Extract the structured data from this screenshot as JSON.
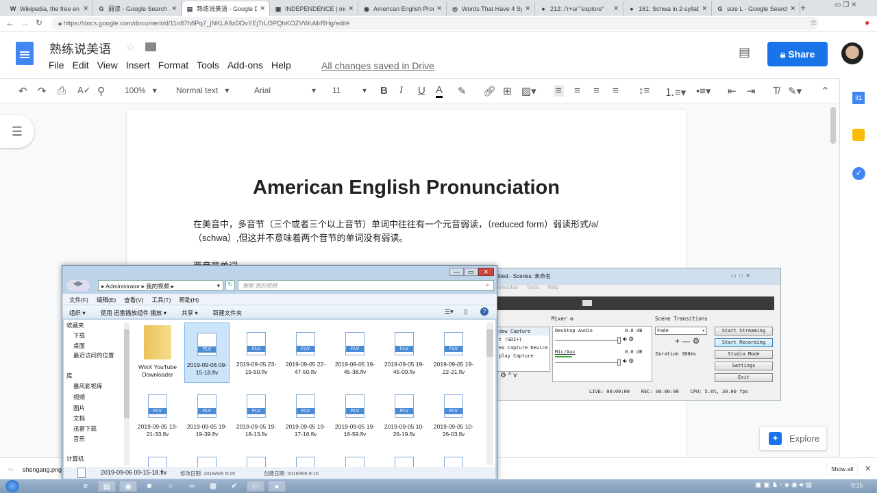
{
  "browser": {
    "tabs": [
      {
        "icon": "W",
        "title": "Wikipedia, the free en"
      },
      {
        "icon": "G",
        "title": "弱读 - Google Search"
      },
      {
        "icon": "▤",
        "title": "熟练说美语 - Google D"
      },
      {
        "icon": "▣",
        "title": "INDEPENDENCE | mea"
      },
      {
        "icon": "◉",
        "title": "American English Pron"
      },
      {
        "icon": "◎",
        "title": "Words That Have 4 Sy"
      },
      {
        "icon": "●",
        "title": "212: /'r+ə/ \"explore\""
      },
      {
        "icon": "●",
        "title": "161: Schwa in 2-syllab"
      },
      {
        "icon": "G",
        "title": "size L - Google Search"
      }
    ],
    "active_tab": 2,
    "url": "https://docs.google.com/document/d/11o87h8Pq7_jNKLA9zDDvYEjTrLOPQhKOZVWuMrRHg/edit#"
  },
  "docs": {
    "title": "熟练说美语",
    "menu": [
      "File",
      "Edit",
      "View",
      "Insert",
      "Format",
      "Tools",
      "Add-ons",
      "Help"
    ],
    "save_status": "All changes saved in Drive",
    "share_label": "Share",
    "toolbar": {
      "zoom": "100%",
      "style": "Normal text",
      "font": "Arial",
      "size": "11"
    },
    "heading": "American English Pronunciation",
    "paragraph1": "在美音中，多音节（三个或者三个以上音节）单词中往往有一个元音弱读，（reduced form）弱读形式/ə/（schwa）,但这并不意味着两个音节的单词没有弱读。",
    "paragraph2": "两音节单词",
    "explore_label": "Explore"
  },
  "explorer": {
    "breadcrumb": [
      "Administrator",
      "我的视频"
    ],
    "search_placeholder": "搜索 我的视频",
    "menu": [
      "文件(F)",
      "编辑(E)",
      "查看(V)",
      "工具(T)",
      "帮助(H)"
    ],
    "commands": [
      "组织 ▾",
      "使用 迅雷播放组件 播放 ▾",
      "共享 ▾",
      "新建文件夹"
    ],
    "nav": [
      "收藏夹",
      "下载",
      "桌面",
      "最近访问的位置",
      "库",
      "暴风影视库",
      "视频",
      "图片",
      "文档",
      "迅雷下载",
      "音乐",
      "计算机"
    ],
    "files": [
      {
        "name": "WinX YouTube Downloader",
        "type": "folder"
      },
      {
        "name": "2019-09-06 09-15-18.flv",
        "type": "FLV",
        "selected": true
      },
      {
        "name": "2019-09-05 23-19-50.flv",
        "type": "FLV"
      },
      {
        "name": "2019-09-05 22-47-50.flv",
        "type": "FLV"
      },
      {
        "name": "2019-09-05 19-45-38.flv",
        "type": "FLV"
      },
      {
        "name": "2019-09-05 19-45-09.flv",
        "type": "FLV"
      },
      {
        "name": "2019-09-05 19-22-21.flv",
        "type": "FLV"
      },
      {
        "name": "2019-09-05 19-21-33.flv",
        "type": "FLV"
      },
      {
        "name": "2019-09-05 19-19-39.flv",
        "type": "FLV"
      },
      {
        "name": "2019-09-05 19-18-13.flv",
        "type": "FLV"
      },
      {
        "name": "2019-09-05 19-17-16.flv",
        "type": "FLV"
      },
      {
        "name": "2019-09-05 19-16-59.flv",
        "type": "FLV"
      },
      {
        "name": "2019-09-05 10-26-19.flv",
        "type": "FLV"
      },
      {
        "name": "2019-09-05 10-26-03.flv",
        "type": "FLV"
      }
    ],
    "details": {
      "name": "2019-09-06 09-15-18.flv",
      "modified": "修改日期: 2019/9/6 9:15",
      "created": "创建日期: 2019/9/6 9:15"
    }
  },
  "obs": {
    "title": "itled - Scenes: 未命名",
    "menu": [
      "ollection",
      "Tools",
      "Help"
    ],
    "sources": [
      "dow Capture",
      "t (GDI+)",
      "eo Capture Device",
      "play Capture"
    ],
    "mixer_label": "Mixer",
    "channels": [
      {
        "name": "Desktop Audio",
        "level": "0.0 dB"
      },
      {
        "name": "Mic/Aux",
        "level": "0.0 dB"
      }
    ],
    "transitions_label": "Scene Transitions",
    "transition": "Fade",
    "duration_label": "Duration",
    "duration": "300ms",
    "buttons": [
      "Start Streaming",
      "Start Recording",
      "Studio Mode",
      "Settings",
      "Exit"
    ],
    "status": {
      "live": "LIVE: 00:00:00",
      "rec": "REC: 00:00:00",
      "cpu": "CPU: 5.6%, 30.00 fps"
    }
  },
  "downloads": {
    "file": "shengang.png",
    "show_all": "Show all"
  },
  "taskbar": {
    "clock": "9:15"
  }
}
